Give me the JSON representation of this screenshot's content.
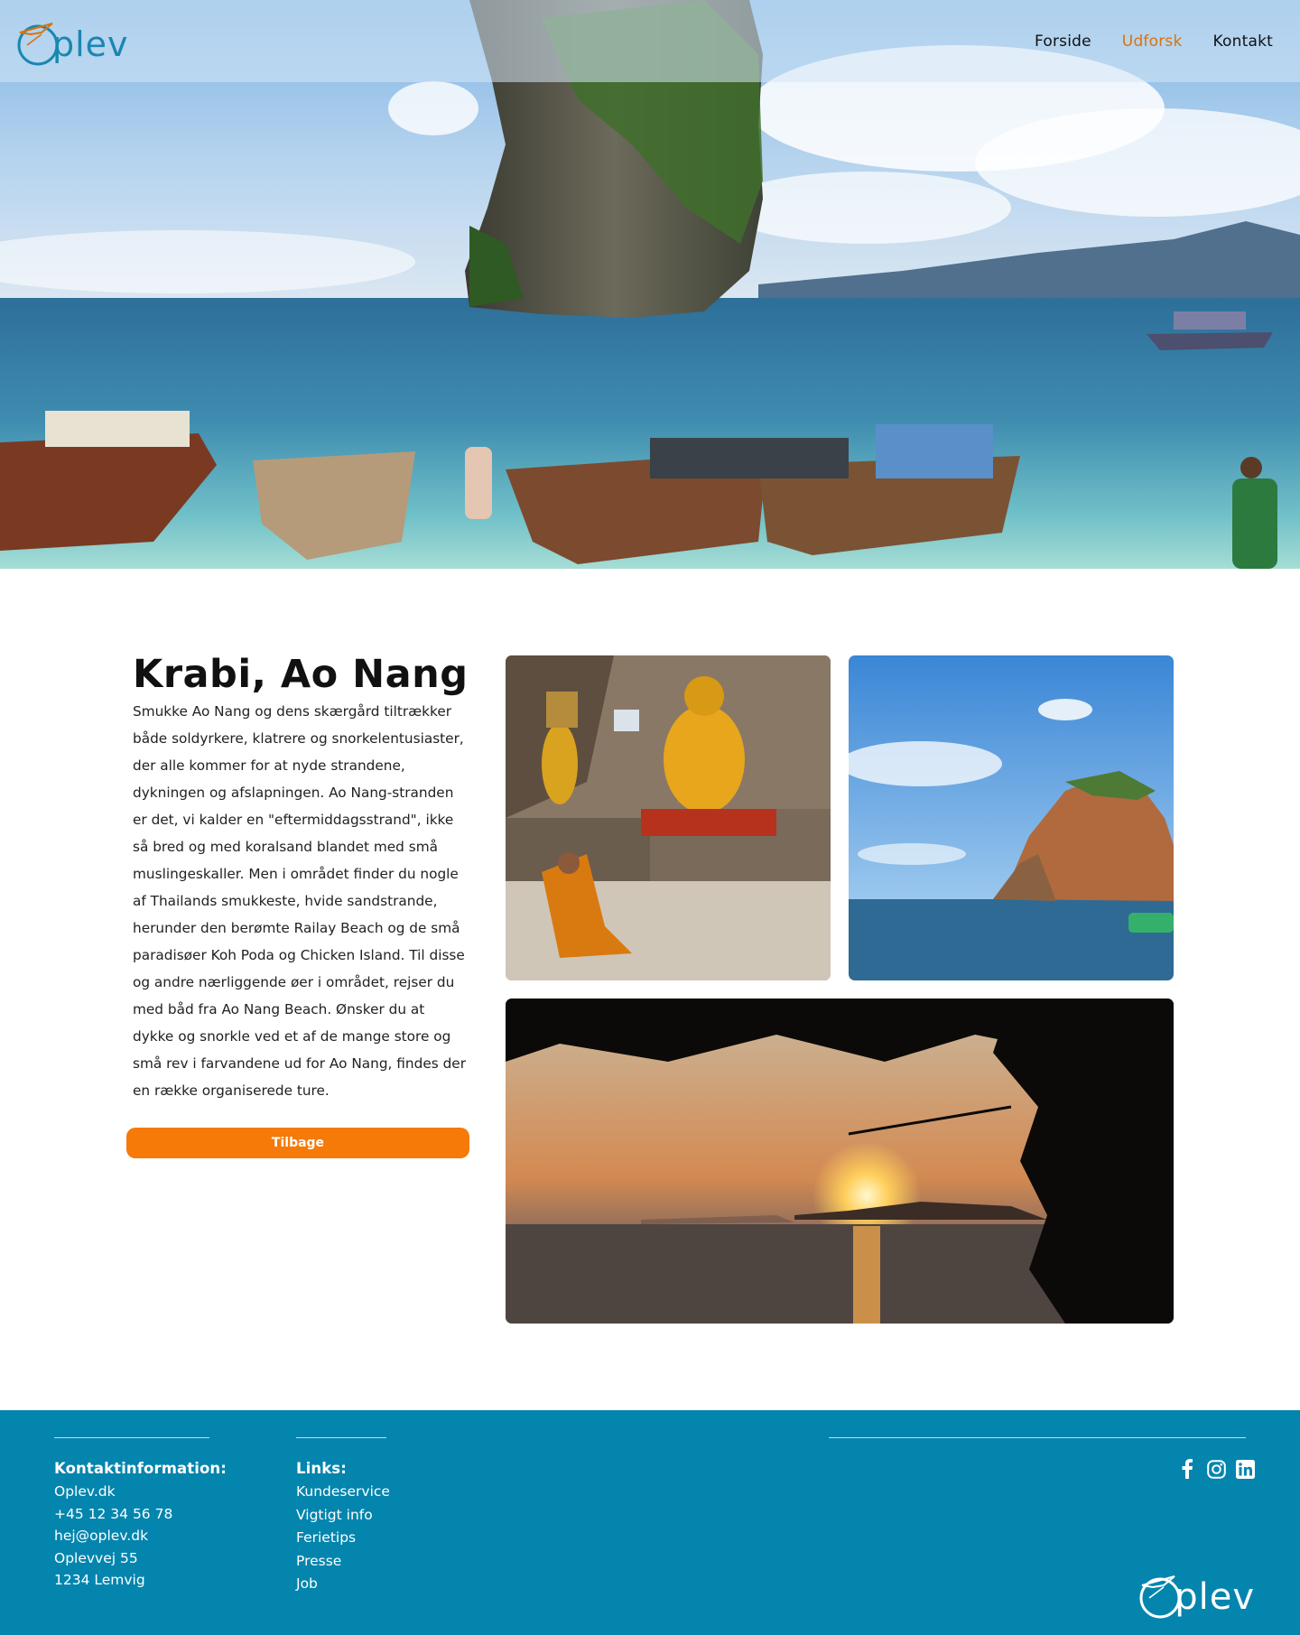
{
  "header": {
    "logo_text": "plev",
    "nav": [
      {
        "label": "Forside"
      },
      {
        "label": "Udforsk"
      },
      {
        "label": "Kontakt"
      }
    ]
  },
  "main": {
    "title": "Krabi, Ao Nang",
    "body": "Smukke Ao Nang og dens skærgård tiltrækker både soldyrkere, klatrere og snorkelentusiaster, der alle kommer for at nyde strandene, dykningen og afslapningen. Ao Nang-stranden er det, vi kalder en \"eftermiddagsstrand\", ikke så bred og med koralsand blandet med små muslingeskaller. Men i området finder du nogle af Thailands smukkeste, hvide sandstrande, herunder den berømte Railay Beach og de små paradisøer Koh Poda og Chicken Island. Til disse og andre nærliggende øer i området, rejser du med båd fra Ao Nang Beach. Ønsker du at dykke og snorkle ved et af de mange store og små rev i farvandene ud for Ao Nang, findes der en række organiserede ture.",
    "back_button": "Tilbage"
  },
  "footer": {
    "contact_heading": "Kontaktinformation:",
    "contact": [
      "Oplev.dk",
      "+45 12 34 56 78",
      "hej@oplev.dk",
      "Oplevvej 55",
      "1234 Lemvig"
    ],
    "links_heading": "Links:",
    "links": [
      "Kundeservice",
      "Vigtigt info",
      "Ferietips",
      "Presse",
      "Job"
    ],
    "logo_text": "plev",
    "social": [
      "facebook-icon",
      "instagram-icon",
      "linkedin-icon"
    ]
  },
  "colors": {
    "accent": "#f57a07",
    "nav_active": "#d9730d",
    "brand_blue": "#1a87b0",
    "footer_bg": "#0385ae"
  }
}
